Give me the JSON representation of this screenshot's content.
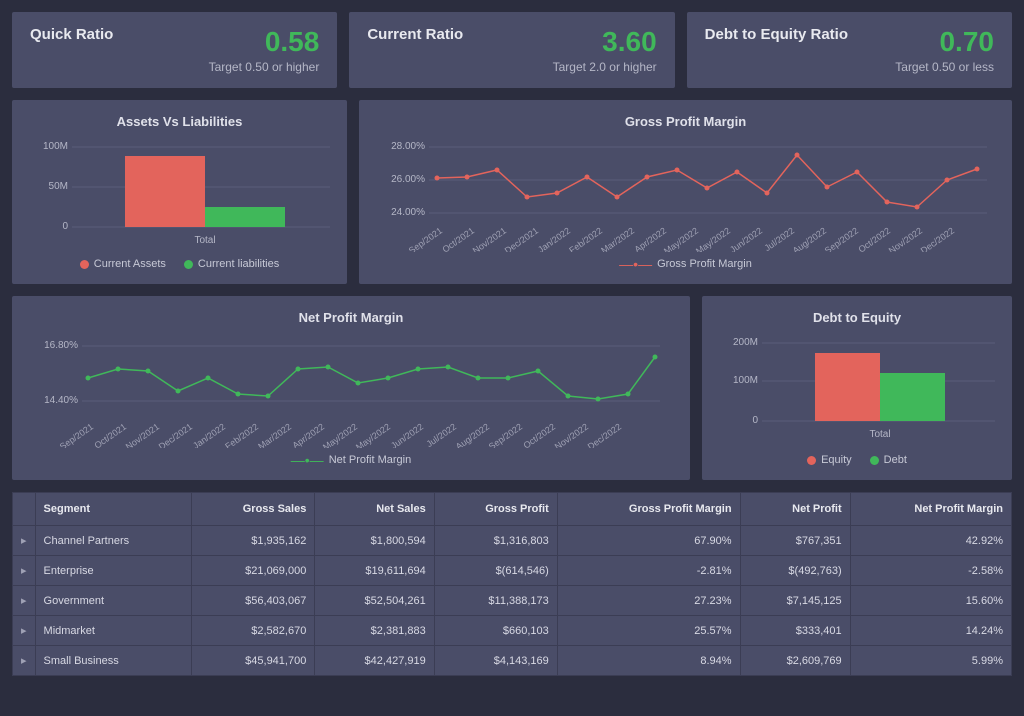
{
  "kpis": [
    {
      "title": "Quick Ratio",
      "value": "0.58",
      "target": "Target 0.50 or higher"
    },
    {
      "title": "Current Ratio",
      "value": "3.60",
      "target": "Target 2.0 or higher"
    },
    {
      "title": "Debt to Equity Ratio",
      "value": "0.70",
      "target": "Target 0.50 or less"
    }
  ],
  "assets_chart": {
    "title": "Assets Vs Liabilities",
    "legend": [
      "Current Assets",
      "Current liabilities"
    ],
    "xlabel": "Total"
  },
  "gpm_chart": {
    "title": "Gross Profit Margin",
    "legend": "Gross Profit Margin"
  },
  "npm_chart": {
    "title": "Net Profit Margin",
    "legend": "Net Profit Margin"
  },
  "de_chart": {
    "title": "Debt to Equity",
    "legend": [
      "Equity",
      "Debt"
    ],
    "xlabel": "Total"
  },
  "table": {
    "headers": [
      "Segment",
      "Gross Sales",
      "Net Sales",
      "Gross Profit",
      "Gross Profit Margin",
      "Net Profit",
      "Net Profit Margin"
    ],
    "rows": [
      [
        "Channel Partners",
        "$1,935,162",
        "$1,800,594",
        "$1,316,803",
        "67.90%",
        "$767,351",
        "42.92%"
      ],
      [
        "Enterprise",
        "$21,069,000",
        "$19,611,694",
        "$(614,546)",
        "-2.81%",
        "$(492,763)",
        "-2.58%"
      ],
      [
        "Government",
        "$56,403,067",
        "$52,504,261",
        "$11,388,173",
        "27.23%",
        "$7,145,125",
        "15.60%"
      ],
      [
        "Midmarket",
        "$2,582,670",
        "$2,381,883",
        "$660,103",
        "25.57%",
        "$333,401",
        "14.24%"
      ],
      [
        "Small Business",
        "$45,941,700",
        "$42,427,919",
        "$4,143,169",
        "8.94%",
        "$2,609,769",
        "5.99%"
      ]
    ]
  },
  "chart_data": [
    {
      "type": "bar",
      "title": "Assets Vs Liabilities",
      "categories": [
        "Total"
      ],
      "series": [
        {
          "name": "Current Assets",
          "values": [
            89
          ]
        },
        {
          "name": "Current liabilities",
          "values": [
            25
          ]
        }
      ],
      "ylabel": "",
      "ylim": [
        0,
        100
      ],
      "y_unit": "M"
    },
    {
      "type": "line",
      "title": "Gross Profit Margin",
      "x": [
        "Sep/2021",
        "Oct/2021",
        "Nov/2021",
        "Dec/2021",
        "Jan/2022",
        "Feb/2022",
        "Mar/2022",
        "Apr/2022",
        "May/2022",
        "May/2022",
        "Jun/2022",
        "Jul/2022",
        "Aug/2022",
        "Sep/2022",
        "Oct/2022",
        "Nov/2022",
        "Dec/2022"
      ],
      "series": [
        {
          "name": "Gross Profit Margin",
          "values": [
            26.1,
            26.2,
            26.6,
            25.0,
            25.2,
            26.2,
            25.0,
            26.2,
            26.6,
            25.5,
            26.5,
            25.2,
            27.5,
            25.6,
            26.5,
            24.6,
            24.3,
            26.0,
            26.7
          ]
        }
      ],
      "ylim": [
        24.0,
        28.0
      ],
      "y_unit": "%"
    },
    {
      "type": "line",
      "title": "Net Profit Margin",
      "x": [
        "Sep/2021",
        "Oct/2021",
        "Nov/2021",
        "Dec/2021",
        "Jan/2022",
        "Feb/2022",
        "Mar/2022",
        "Apr/2022",
        "May/2022",
        "May/2022",
        "Jun/2022",
        "Jul/2022",
        "Aug/2022",
        "Sep/2022",
        "Oct/2022",
        "Nov/2022",
        "Dec/2022"
      ],
      "series": [
        {
          "name": "Net Profit Margin",
          "values": [
            15.4,
            15.8,
            15.7,
            14.8,
            15.4,
            14.7,
            14.6,
            15.8,
            15.9,
            15.2,
            15.4,
            15.8,
            15.9,
            15.4,
            15.4,
            15.7,
            14.6,
            14.5,
            14.7,
            16.3
          ]
        }
      ],
      "ylim": [
        14.4,
        16.8
      ],
      "y_unit": "%"
    },
    {
      "type": "bar",
      "title": "Debt to Equity",
      "categories": [
        "Total"
      ],
      "series": [
        {
          "name": "Equity",
          "values": [
            175
          ]
        },
        {
          "name": "Debt",
          "values": [
            122
          ]
        }
      ],
      "ylabel": "",
      "ylim": [
        0,
        200
      ],
      "y_unit": "M"
    }
  ]
}
